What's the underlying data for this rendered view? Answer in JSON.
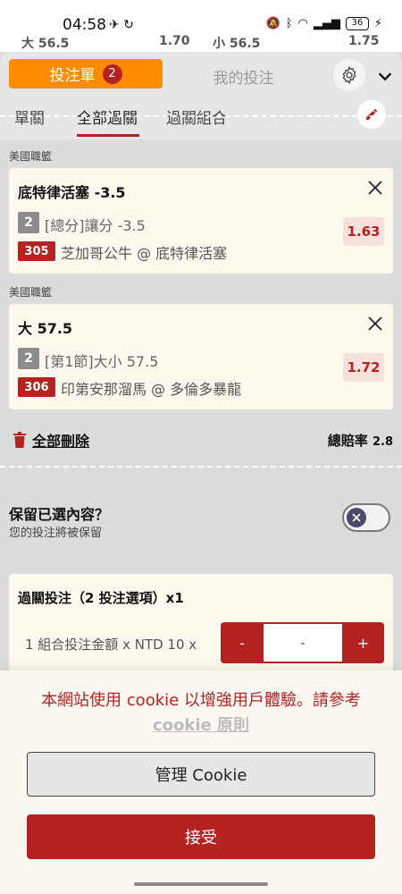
{
  "status_bar": {
    "time": "04:58",
    "battery": "36"
  },
  "peek_row": {
    "a": "大 56.5",
    "b": "1.70",
    "c": "小 56.5",
    "d": "1.75"
  },
  "header": {
    "active_tab": "投注單",
    "badge_count": "2",
    "inactive_tab": "我的投注"
  },
  "subtabs": {
    "tab1": "單關",
    "tab2": "全部過關",
    "tab3": "過關組合"
  },
  "bets": [
    {
      "league": "美國職籃",
      "title": "底特律活塞 -3.5",
      "num": "2",
      "desc": "[總分]讓分 -3.5",
      "match_num": "305",
      "match": "芝加哥公牛 @ 底特律活塞",
      "odds": "1.63"
    },
    {
      "league": "美國職籃",
      "title": "大 57.5",
      "num": "2",
      "desc": "[第1節]大小 57.5",
      "match_num": "306",
      "match": "印第安那溜馬 @ 多倫多暴龍",
      "odds": "1.72"
    }
  ],
  "actions": {
    "delete_all": "全部刪除",
    "total_odds_label": "總賠率",
    "total_odds_value": "2.8"
  },
  "keep": {
    "title": "保留已選內容？",
    "subtitle": "您的投注將被保留"
  },
  "parlay": {
    "title": "過關投注（2 投注選項）x1",
    "stake_label": "1 組合投注金額 x NTD 10 x",
    "minus": "-",
    "input_value": "-",
    "plus": "+"
  },
  "cookie": {
    "text": "本網站使用 cookie 以增強用戶體驗。請參考",
    "link": "cookie 原則",
    "manage": "管理 Cookie",
    "accept": "接受"
  }
}
